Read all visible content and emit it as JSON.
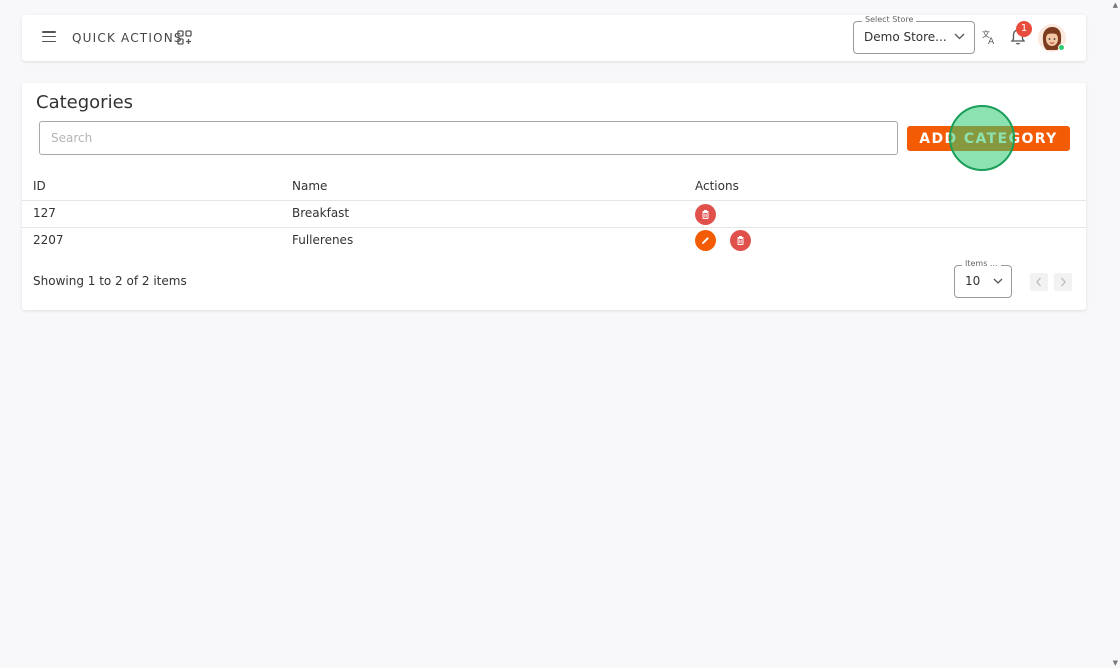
{
  "header": {
    "quick_actions_label": "QUICK ACTIONS",
    "store_select": {
      "legend": "Select Store",
      "value": "Demo Store..."
    },
    "notification_count": "1"
  },
  "main": {
    "title": "Categories",
    "search": {
      "placeholder": "Search",
      "value": ""
    },
    "add_button_label": "ADD CATEGORY",
    "table": {
      "columns": [
        "ID",
        "Name",
        "Actions"
      ],
      "rows": [
        {
          "id": "127",
          "name": "Breakfast",
          "actions": [
            "delete"
          ]
        },
        {
          "id": "2207",
          "name": "Fullerenes",
          "actions": [
            "edit",
            "delete"
          ]
        }
      ]
    },
    "pagination": {
      "summary": "Showing 1 to 2 of 2 items",
      "items_per_page_legend": "Items ...",
      "items_per_page_value": "10"
    }
  },
  "colors": {
    "accent": "#f35b04",
    "danger": "#e0514c",
    "badge": "#e74c3c",
    "online": "#2ecc71",
    "click_indicator": "#2ecc71"
  },
  "icons": [
    "menu-icon",
    "quick-actions-grid-icon",
    "chevron-down-icon",
    "translate-icon",
    "bell-icon",
    "trash-icon",
    "pencil-icon",
    "chevron-left-icon",
    "chevron-right-icon"
  ]
}
